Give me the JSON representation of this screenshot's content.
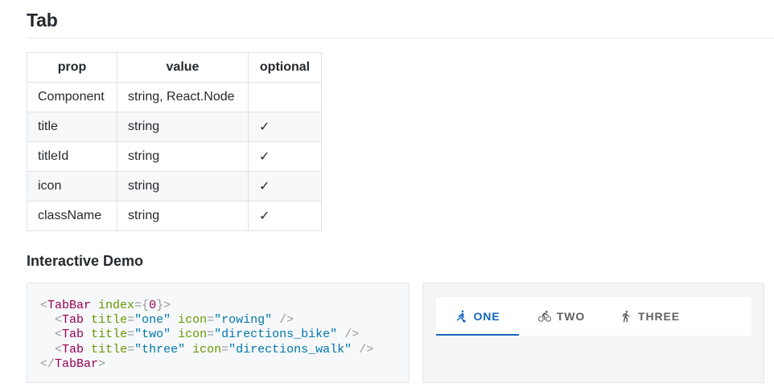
{
  "page": {
    "title": "Tab"
  },
  "props_table": {
    "headers": [
      "prop",
      "value",
      "optional"
    ],
    "rows": [
      {
        "prop": "Component",
        "value": "string, React.Node",
        "optional": ""
      },
      {
        "prop": "title",
        "value": "string",
        "optional": "✓"
      },
      {
        "prop": "titleId",
        "value": "string",
        "optional": "✓"
      },
      {
        "prop": "icon",
        "value": "string",
        "optional": "✓"
      },
      {
        "prop": "className",
        "value": "string",
        "optional": "✓"
      }
    ]
  },
  "demo": {
    "section_title": "Interactive Demo",
    "code": {
      "line1": {
        "open": "<",
        "tag": "TabBar",
        "sp": " ",
        "attr": "index",
        "eq": "={",
        "num": "0",
        "close": "}>"
      },
      "line2": {
        "indent": "  ",
        "open": "<",
        "tag": "Tab",
        "sp1": " ",
        "attr1": "title",
        "eq1": "=",
        "val1": "\"one\"",
        "sp2": " ",
        "attr2": "icon",
        "eq2": "=",
        "val2": "\"rowing\"",
        "close": " />"
      },
      "line3": {
        "indent": "  ",
        "open": "<",
        "tag": "Tab",
        "sp1": " ",
        "attr1": "title",
        "eq1": "=",
        "val1": "\"two\"",
        "sp2": " ",
        "attr2": "icon",
        "eq2": "=",
        "val2": "\"directions_bike\"",
        "close": " />"
      },
      "line4": {
        "indent": "  ",
        "open": "<",
        "tag": "Tab",
        "sp1": " ",
        "attr1": "title",
        "eq1": "=",
        "val1": "\"three\"",
        "sp2": " ",
        "attr2": "icon",
        "eq2": "=",
        "val2": "\"directions_walk\"",
        "close": " />"
      },
      "line5": {
        "open": "</",
        "tag": "TabBar",
        "close": ">"
      }
    },
    "tabbar": {
      "active_index": 0,
      "tabs": [
        {
          "label": "ONE",
          "icon": "rowing-icon"
        },
        {
          "label": "TWO",
          "icon": "directions-bike-icon"
        },
        {
          "label": "THREE",
          "icon": "directions-walk-icon"
        }
      ]
    }
  },
  "colors": {
    "accent": "#1565c0",
    "tab_inactive": "#616161",
    "code_tag": "#990055",
    "code_attr": "#669900",
    "code_string": "#0077aa",
    "code_punct": "#999999"
  }
}
